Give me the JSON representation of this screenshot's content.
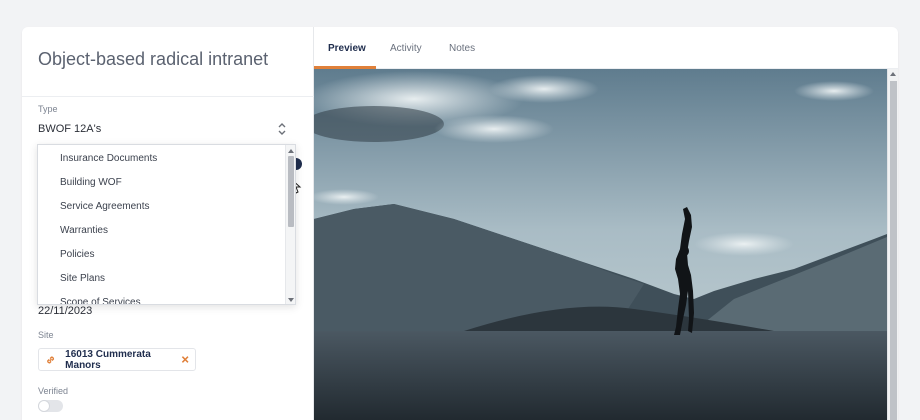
{
  "record": {
    "title": "Object-based radical intranet"
  },
  "form": {
    "type_label": "Type",
    "type_value": "BWOF 12A's",
    "date_value": "22/11/2023",
    "site_label": "Site",
    "site_chip": "16013 Cummerata Manors",
    "verified_label": "Verified",
    "verified_on": false
  },
  "dropdown": {
    "options": [
      "Insurance Documents",
      "Building WOF",
      "Service Agreements",
      "Warranties",
      "Policies",
      "Site Plans",
      "Scope of Services"
    ]
  },
  "tabs": [
    {
      "label": "Preview",
      "active": true
    },
    {
      "label": "Activity",
      "active": false
    },
    {
      "label": "Notes",
      "active": false
    }
  ],
  "colors": {
    "accent": "#e0803a",
    "navy": "#1f2d4d"
  },
  "icons": {
    "select": "chevron-up-down-icon",
    "chip": "link-icon",
    "remove": "close-icon"
  }
}
